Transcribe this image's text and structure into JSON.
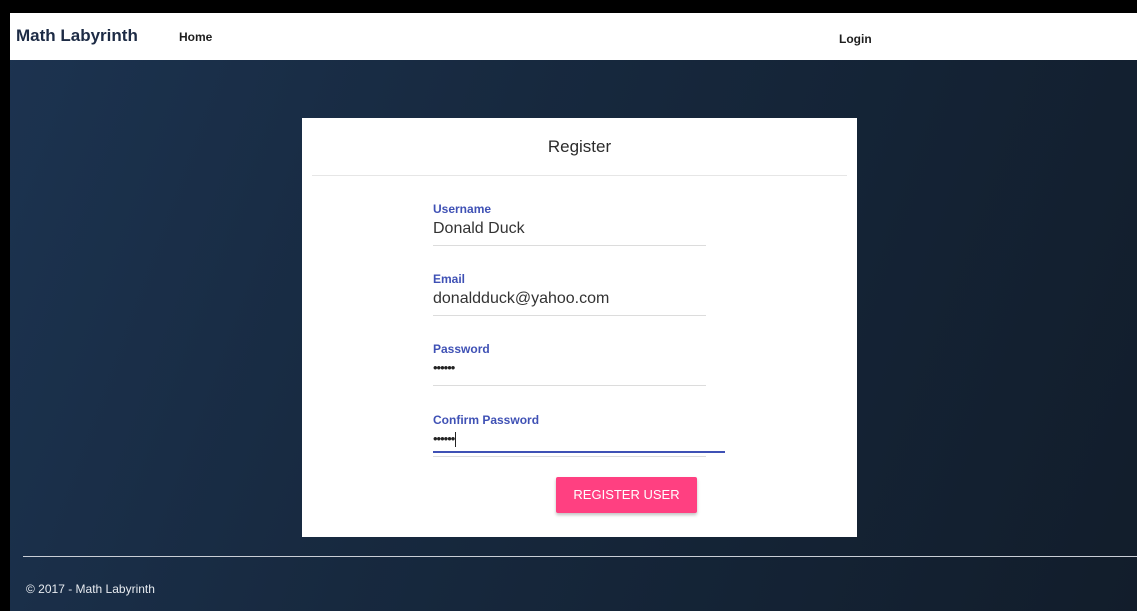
{
  "nav": {
    "brand": "Math Labyrinth",
    "home": "Home",
    "login": "Login"
  },
  "form": {
    "title": "Register",
    "username": {
      "label": "Username",
      "value": "Donald Duck"
    },
    "email": {
      "label": "Email",
      "value": "donaldduck@yahoo.com"
    },
    "password": {
      "label": "Password",
      "value": "••••••"
    },
    "confirm_password": {
      "label": "Confirm Password",
      "value": "••••••"
    },
    "submit": "REGISTER USER"
  },
  "footer": {
    "text": "© 2017 - Math Labyrinth"
  },
  "colors": {
    "accent": "#3f51b5",
    "button": "#ff4081",
    "background": "#17293f"
  }
}
